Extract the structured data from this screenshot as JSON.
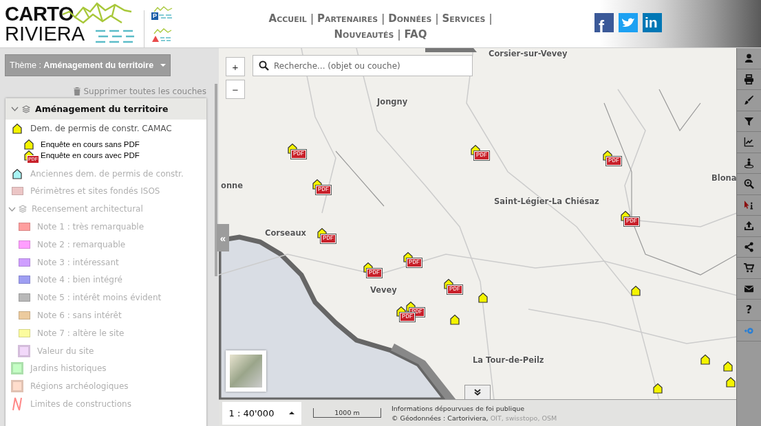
{
  "logo": {
    "line_1": "CARTO",
    "line_2": "RIVIERA",
    "badges": [
      {
        "kind": "parking",
        "glyph": "P"
      },
      {
        "kind": "warning"
      }
    ]
  },
  "nav": [
    [
      {
        "kind": "link",
        "label": "Accueil"
      },
      {
        "kind": "separator",
        "label": "|"
      },
      {
        "kind": "link",
        "label": "Partenaires"
      },
      {
        "kind": "separator",
        "label": "|"
      },
      {
        "kind": "link",
        "label": "Données"
      },
      {
        "kind": "separator",
        "label": "|"
      },
      {
        "kind": "link",
        "label": "Services"
      },
      {
        "kind": "separator",
        "label": "|"
      }
    ],
    [
      {
        "kind": "link",
        "label": "Nouveautés"
      },
      {
        "kind": "separator",
        "label": "|"
      },
      {
        "kind": "link",
        "label": "FAQ"
      }
    ]
  ],
  "social": [
    {
      "kind": "facebook",
      "glyph": "f"
    },
    {
      "kind": "twitter"
    },
    {
      "kind": "linkedin",
      "glyph": "in"
    }
  ],
  "theme_button": "Thème : **Aménagement du territoire**",
  "remove_all": "Supprimer toutes les couches",
  "layer_tree": {
    "title": "Aménagement du territoire",
    "expanded": true,
    "items": [
      {
        "kind": "symbol",
        "label": "Dem. de permis de constr. CAMAC",
        "active": true,
        "color": "#f4f400",
        "legend": [
          {
            "kind": "house",
            "label": "Enquête en cours sans PDF"
          },
          {
            "kind": "house-pdf",
            "label": "Enquête en cours avec PDF",
            "badge": "PDF"
          }
        ]
      },
      {
        "kind": "symbol",
        "label": "Anciennes dem. de permis de constr.",
        "active": false,
        "color": "#a8f4f4"
      },
      {
        "kind": "swatch",
        "label": "Périmètres et sites fondés ISOS",
        "active": false,
        "color": "#ecc6c6"
      },
      {
        "kind": "group",
        "label": "Recensement architectural",
        "active": false,
        "expanded": true,
        "children": [
          {
            "kind": "swatch",
            "label": "Note 1 : très remarquable",
            "active": false,
            "color": "#ff9e9e"
          },
          {
            "kind": "swatch",
            "label": "Note 2 : remarquable",
            "active": false,
            "color": "#ff9eff"
          },
          {
            "kind": "swatch",
            "label": "Note 3 : intéressant",
            "active": false,
            "color": "#cf9eff"
          },
          {
            "kind": "swatch",
            "label": "Note 4 : bien intégré",
            "active": false,
            "color": "#9e9ef2"
          },
          {
            "kind": "swatch",
            "label": "Note 5 : intérêt moins évident",
            "active": false,
            "color": "#b8b8b8"
          },
          {
            "kind": "swatch",
            "label": "Note 6 : sans intérêt",
            "active": false,
            "color": "#eccb9e"
          },
          {
            "kind": "swatch",
            "label": "Note 7 : altère le site",
            "active": false,
            "color": "#fcfc9e"
          },
          {
            "kind": "outlined",
            "label": "Valeur du site",
            "active": false,
            "color": "#f2d8fa"
          }
        ]
      },
      {
        "kind": "outlined",
        "label": "Jardins historiques",
        "active": false,
        "color": "#c4ffc4"
      },
      {
        "kind": "outlined",
        "label": "Régions archéologiques",
        "active": false,
        "color": "#ffddcc"
      },
      {
        "kind": "line",
        "label": "Limites de constructions",
        "active": false,
        "color": "#ff8888"
      }
    ]
  },
  "collapse_button": "«",
  "map": {
    "zoom_in": "+",
    "zoom_out": "−",
    "search": {
      "placeholder": "Recherche... (objet ou couche)"
    },
    "places": [
      "Corsier-sur-Vevey",
      "Jongny",
      "onne",
      "Saint-Légier-La Chiésaz",
      "Blona",
      "Corseaux",
      "Vevey",
      "La Tour-de-Peilz"
    ],
    "markers": [
      {
        "kind": "house-pdf",
        "badge": "PDF"
      },
      {
        "kind": "house-pdf",
        "badge": "PDF"
      },
      {
        "kind": "house-pdf",
        "badge": "PDF"
      },
      {
        "kind": "house-pdf",
        "badge": "PDF"
      },
      {
        "kind": "house-pdf",
        "badge": "PDF"
      },
      {
        "kind": "house-pdf",
        "badge": "PDF"
      },
      {
        "kind": "house-pdf",
        "badge": "PDF"
      },
      {
        "kind": "house-pdf",
        "badge": "PDF"
      },
      {
        "kind": "house-pdf",
        "badge": "PDF"
      },
      {
        "kind": "house-pdf",
        "badge": "PDF"
      },
      {
        "kind": "house-pdf",
        "badge": "PDF"
      },
      {
        "kind": "house"
      },
      {
        "kind": "house"
      },
      {
        "kind": "house"
      },
      {
        "kind": "house"
      },
      {
        "kind": "house"
      },
      {
        "kind": "house"
      },
      {
        "kind": "house"
      }
    ]
  },
  "status_bar": {
    "scale": "1 : 40'000",
    "scale_bar": "1000 m",
    "disclaimer": "Informations dépourvues de foi publique",
    "attribution_prefix": "© Géodonnées : Cartoriviera,",
    "attribution_sources": "OIT, swisstopo, OSM"
  },
  "toolbar": [
    {
      "kind": "user"
    },
    {
      "kind": "print"
    },
    {
      "kind": "brush"
    },
    {
      "kind": "filter"
    },
    {
      "kind": "chart"
    },
    {
      "kind": "street-view"
    },
    {
      "kind": "zoom"
    },
    {
      "kind": "info-pointer"
    },
    {
      "kind": "upload"
    },
    {
      "kind": "share"
    },
    {
      "kind": "cart"
    },
    {
      "kind": "mail"
    },
    {
      "kind": "help",
      "glyph": "?"
    },
    {
      "kind": "locate"
    }
  ]
}
